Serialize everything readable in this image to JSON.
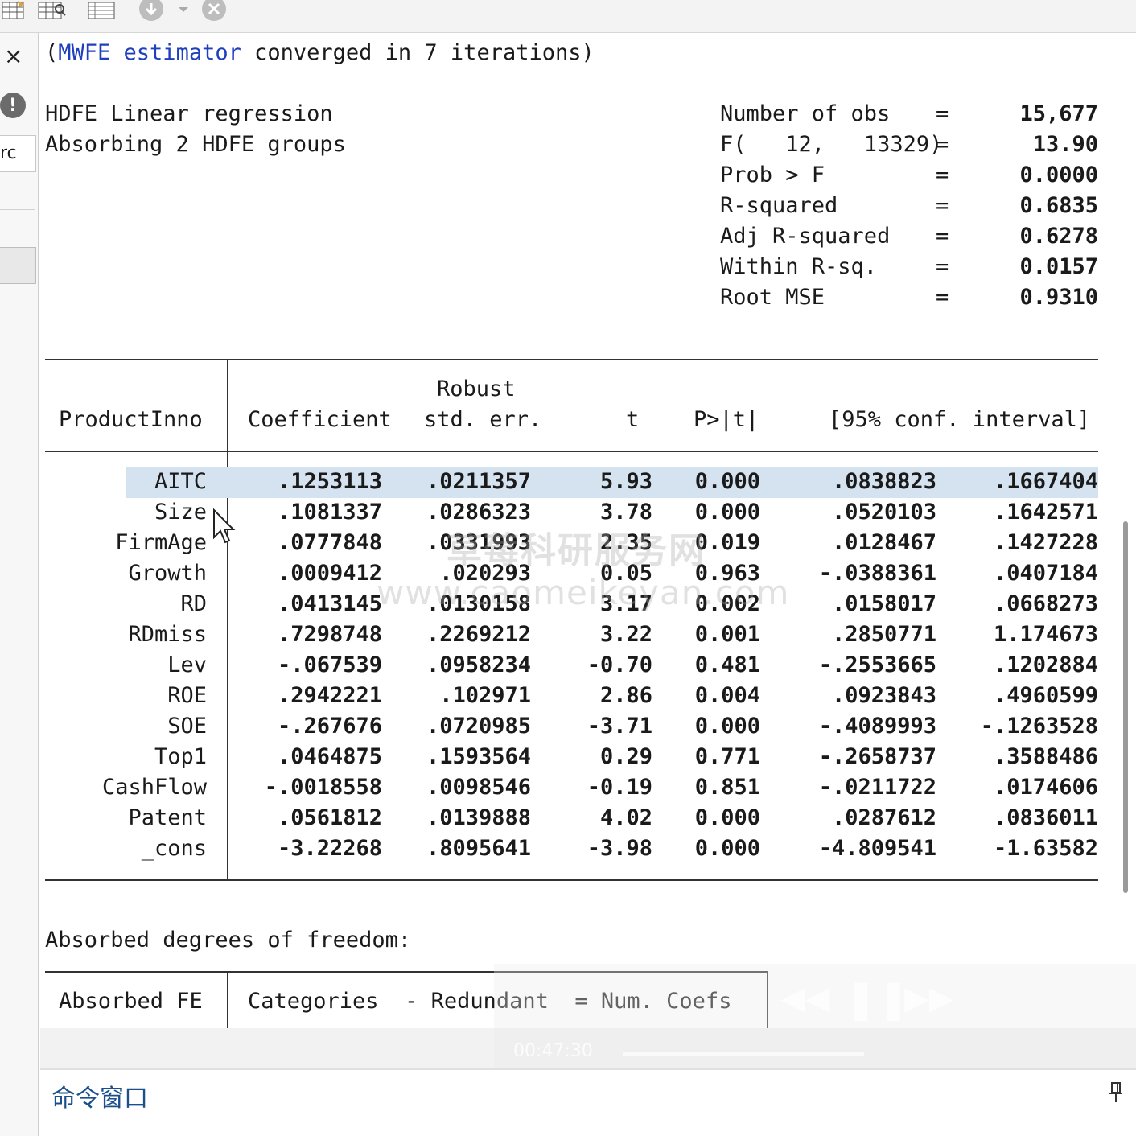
{
  "toolbar": {
    "icons": [
      "data-editor-icon",
      "data-browser-icon",
      "variables-manager-icon",
      "more-icon",
      "dropdown-icon",
      "break-icon"
    ]
  },
  "left_panel": {
    "close_symbol": "×",
    "warn_symbol": "!",
    "field_text": "rc"
  },
  "output": {
    "converged_prefix": "(",
    "converged_estimator": "MWFE estimator",
    "converged_rest": " converged in 7 iterations)",
    "title_line1": "HDFE Linear regression",
    "title_line2": "Absorbing 2 HDFE groups",
    "stats": [
      {
        "label": "Number of obs",
        "value": "15,677"
      },
      {
        "label": "F(   12,   13329)",
        "value": "13.90"
      },
      {
        "label": "Prob > F",
        "value": "0.0000"
      },
      {
        "label": "R-squared",
        "value": "0.6835"
      },
      {
        "label": "Adj R-squared",
        "value": "0.6278"
      },
      {
        "label": "Within R-sq.",
        "value": "0.0157"
      },
      {
        "label": "Root MSE",
        "value": "0.9310"
      }
    ],
    "eq_sign": "=",
    "table": {
      "depvar": "ProductInno",
      "headers": {
        "coef": "Coefficient",
        "robust": "Robust",
        "se": "std. err.",
        "t": "t",
        "p": "P>|t|",
        "ci": "[95% conf. interval]"
      },
      "rows": [
        {
          "var": "AITC",
          "coef": ".1253113",
          "se": ".0211357",
          "t": "5.93",
          "p": "0.000",
          "lo": ".0838823",
          "hi": ".1667404"
        },
        {
          "var": "Size",
          "coef": ".1081337",
          "se": ".0286323",
          "t": "3.78",
          "p": "0.000",
          "lo": ".0520103",
          "hi": ".1642571"
        },
        {
          "var": "FirmAge",
          "coef": ".0777848",
          "se": ".0331993",
          "t": "2.35",
          "p": "0.019",
          "lo": ".0128467",
          "hi": ".1427228"
        },
        {
          "var": "Growth",
          "coef": ".0009412",
          "se": ".020293",
          "t": "0.05",
          "p": "0.963",
          "lo": "-.0388361",
          "hi": ".0407184"
        },
        {
          "var": "RD",
          "coef": ".0413145",
          "se": ".0130158",
          "t": "3.17",
          "p": "0.002",
          "lo": ".0158017",
          "hi": ".0668273"
        },
        {
          "var": "RDmiss",
          "coef": ".7298748",
          "se": ".2269212",
          "t": "3.22",
          "p": "0.001",
          "lo": ".2850771",
          "hi": "1.174673"
        },
        {
          "var": "Lev",
          "coef": "-.067539",
          "se": ".0958234",
          "t": "-0.70",
          "p": "0.481",
          "lo": "-.2553665",
          "hi": ".1202884"
        },
        {
          "var": "ROE",
          "coef": ".2942221",
          "se": ".102971",
          "t": "2.86",
          "p": "0.004",
          "lo": ".0923843",
          "hi": ".4960599"
        },
        {
          "var": "SOE",
          "coef": "-.267676",
          "se": ".0720985",
          "t": "-3.71",
          "p": "0.000",
          "lo": "-.4089993",
          "hi": "-.1263528"
        },
        {
          "var": "Top1",
          "coef": ".0464875",
          "se": ".1593564",
          "t": "0.29",
          "p": "0.771",
          "lo": "-.2658737",
          "hi": ".3588486"
        },
        {
          "var": "CashFlow",
          "coef": "-.0018558",
          "se": ".0098546",
          "t": "-0.19",
          "p": "0.851",
          "lo": "-.0211722",
          "hi": ".0174606"
        },
        {
          "var": "Patent",
          "coef": ".0561812",
          "se": ".0139888",
          "t": "4.02",
          "p": "0.000",
          "lo": ".0287612",
          "hi": ".0836011"
        },
        {
          "var": "_cons",
          "coef": "-3.22268",
          "se": ".8095641",
          "t": "-3.98",
          "p": "0.000",
          "lo": "-4.809541",
          "hi": "-1.63582"
        }
      ]
    },
    "absorbed_title": "Absorbed degrees of freedom:",
    "absorbed_headers": {
      "fe": "Absorbed FE",
      "rest": "Categories  - Redundant  = Num. Coefs"
    }
  },
  "watermark": {
    "cn": "草莓科研服务网",
    "url": "www.caomeikeyan.com"
  },
  "player": {
    "time": "00:47:30"
  },
  "command_window": {
    "title": "命令窗口",
    "pin_symbol": "📌"
  },
  "colors": {
    "highlight_row": "#d5e3f1",
    "keyword_blue": "#1f3fbf",
    "title_blue": "#1b4f8a"
  }
}
